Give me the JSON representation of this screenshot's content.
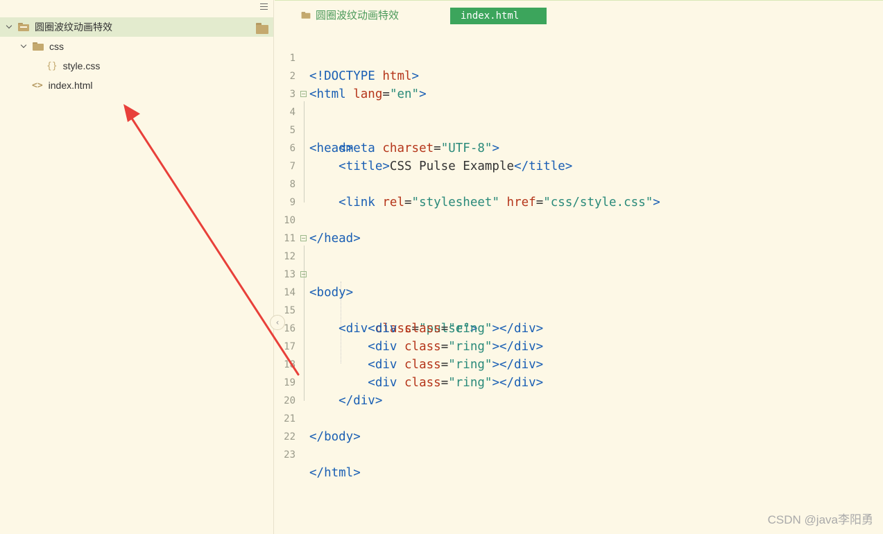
{
  "sidebar": {
    "project": {
      "name": "圆圈波纹动画特效",
      "icon": "folder-icon"
    },
    "items": [
      {
        "label": "css",
        "icon": "folder-icon",
        "type": "folder"
      },
      {
        "label": "style.css",
        "icon": "braces-icon",
        "type": "file"
      },
      {
        "label": "index.html",
        "icon": "code-icon",
        "type": "file"
      }
    ]
  },
  "editor": {
    "breadcrumb": "圆圈波纹动画特效",
    "active_tab": "index.html",
    "line_numbers": [
      "1",
      "2",
      "3",
      "4",
      "5",
      "6",
      "7",
      "8",
      "9",
      "10",
      "11",
      "12",
      "13",
      "14",
      "15",
      "16",
      "17",
      "18",
      "19",
      "20",
      "21",
      "22",
      "23"
    ]
  },
  "watermark": "CSDN @java李阳勇",
  "colors": {
    "background": "#fdf8e6",
    "tab_green": "#3ca55c",
    "selected_row": "#e3ebce",
    "tag": "#1a5fb4",
    "attribute": "#b5361b",
    "string": "#2a8a7a",
    "arrow": "#e8403a"
  }
}
